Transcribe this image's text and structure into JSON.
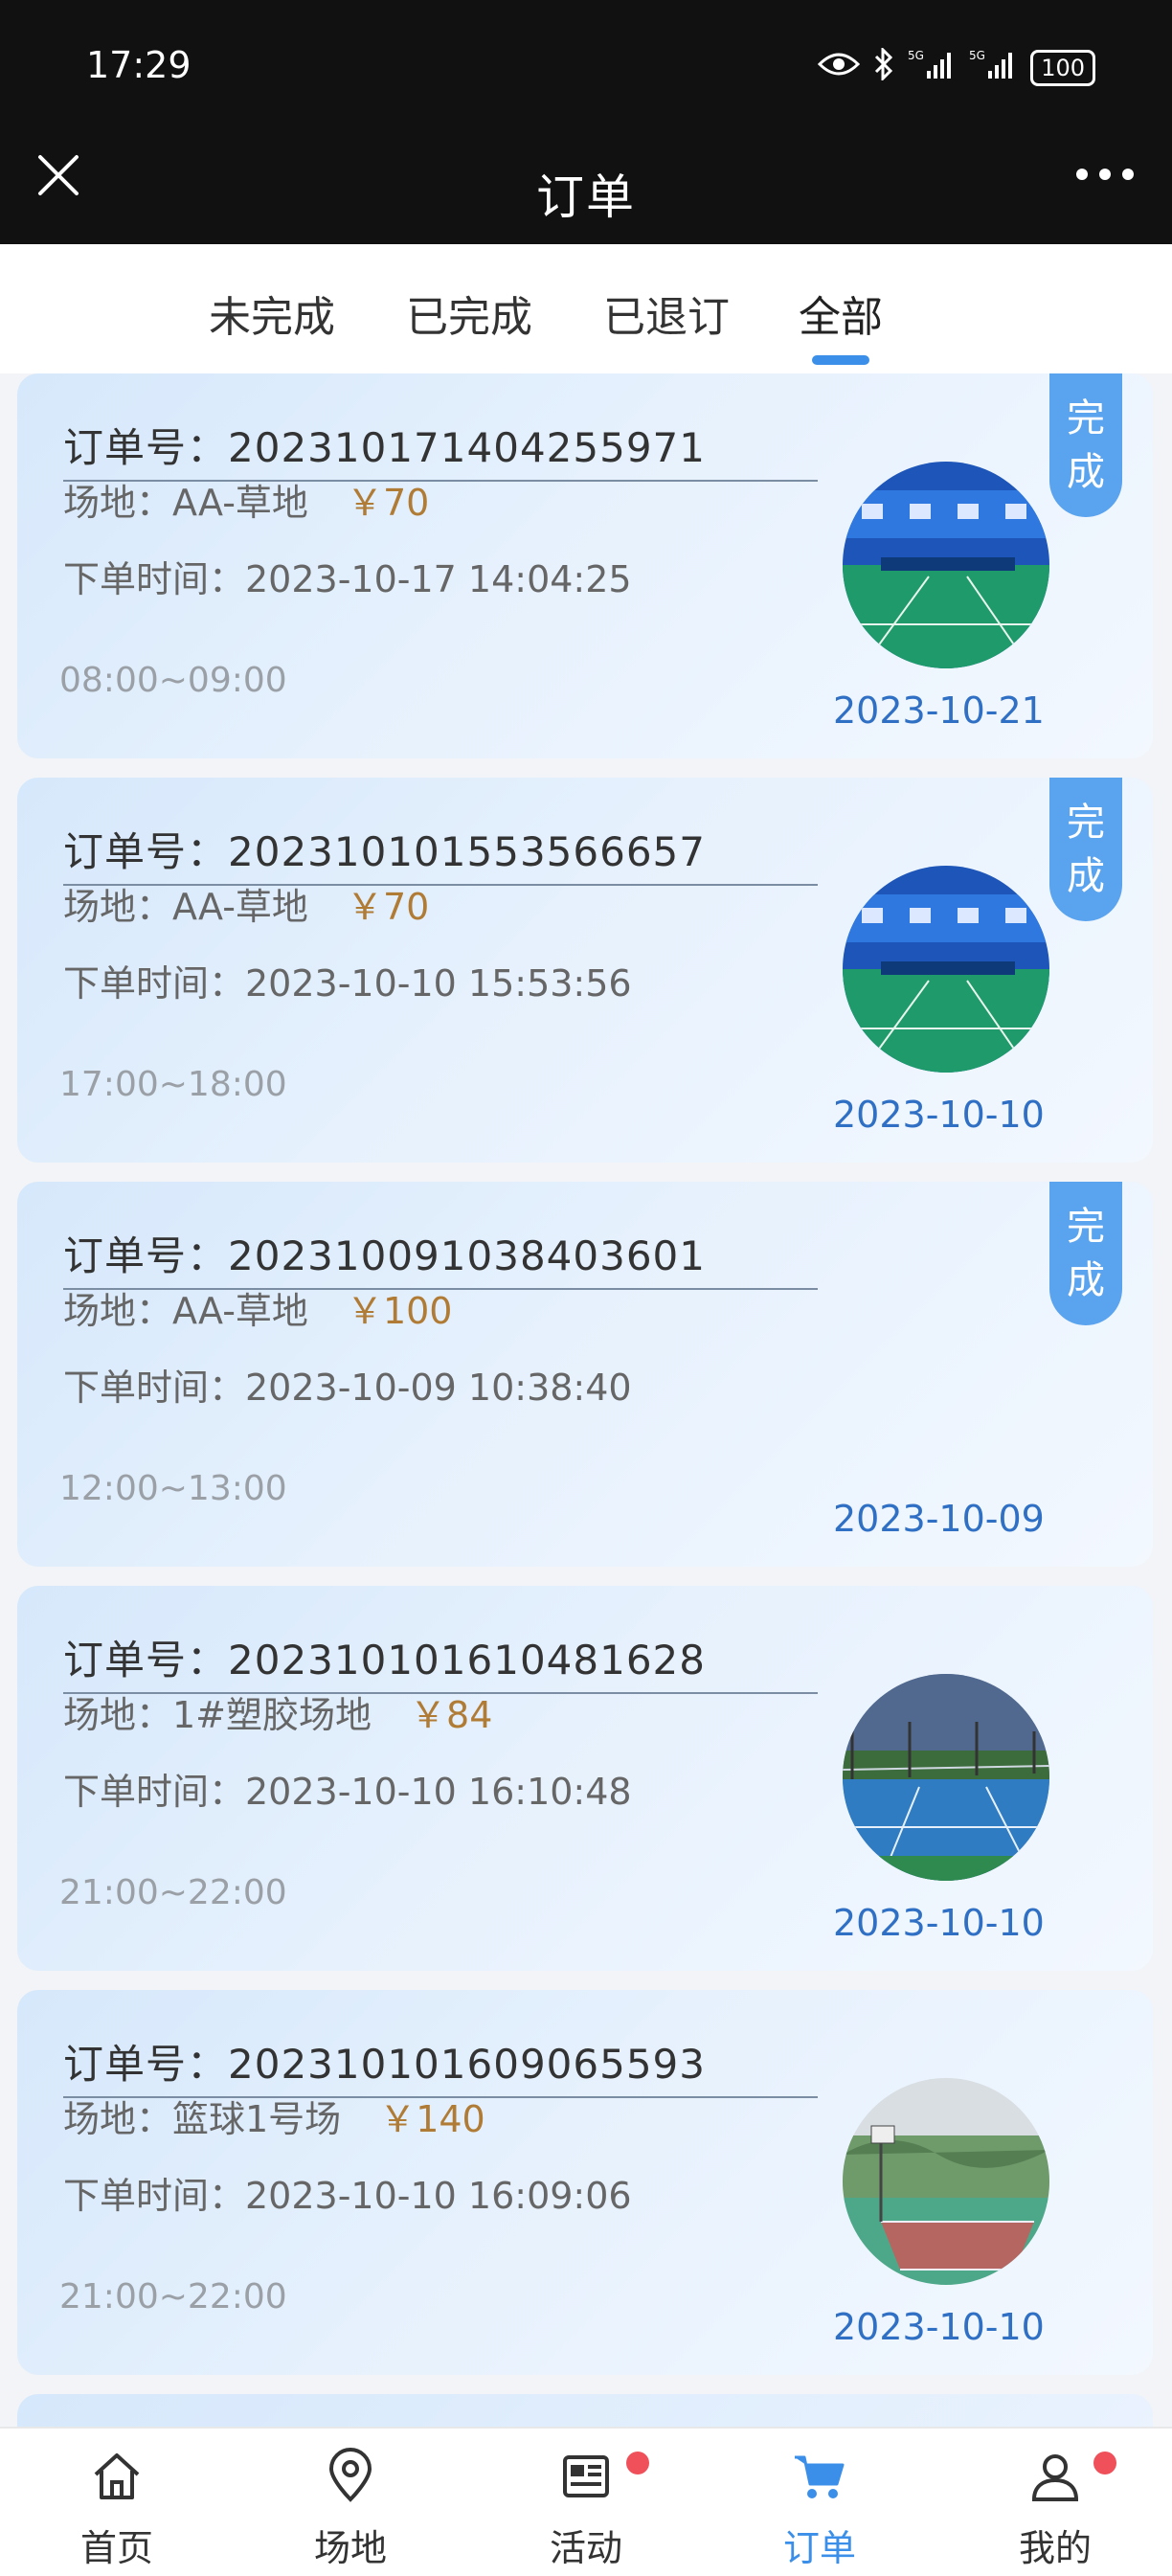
{
  "status_bar": {
    "time": "17:29",
    "battery": "100"
  },
  "nav": {
    "title": "订单"
  },
  "tabs": [
    {
      "label": "未完成"
    },
    {
      "label": "已完成"
    },
    {
      "label": "已退订"
    },
    {
      "label": "全部",
      "active": true
    }
  ],
  "orders": [
    {
      "order_no": "订单号：202310171404255971",
      "venue": "场地：AA-草地",
      "price": "￥70",
      "order_time": "下单时间：2023-10-17 14:04:25",
      "time_slot": "08:00~09:00",
      "date": "2023-10-21",
      "badge": [
        "完",
        "成"
      ],
      "thumb": "badminton-court"
    },
    {
      "order_no": "订单号：202310101553566657",
      "venue": "场地：AA-草地",
      "price": "￥70",
      "order_time": "下单时间：2023-10-10 15:53:56",
      "time_slot": "17:00~18:00",
      "date": "2023-10-10",
      "badge": [
        "完",
        "成"
      ],
      "thumb": "badminton-court"
    },
    {
      "order_no": "订单号：202310091038403601",
      "venue": "场地：AA-草地",
      "price": "￥100",
      "order_time": "下单时间：2023-10-09 10:38:40",
      "time_slot": "12:00~13:00",
      "date": "2023-10-09",
      "badge": [
        "完",
        "成"
      ],
      "thumb": ""
    },
    {
      "order_no": "订单号：202310101610481628",
      "venue": "场地：1#塑胶场地",
      "price": "￥84",
      "order_time": "下单时间：2023-10-10 16:10:48",
      "time_slot": "21:00~22:00",
      "date": "2023-10-10",
      "badge": [],
      "thumb": "tennis-court"
    },
    {
      "order_no": "订单号：202310101609065593",
      "venue": "场地：篮球1号场",
      "price": "￥140",
      "order_time": "下单时间：2023-10-10 16:09:06",
      "time_slot": "21:00~22:00",
      "date": "2023-10-10",
      "badge": [],
      "thumb": "basketball-court"
    }
  ],
  "bottom_nav": [
    {
      "label": "首页",
      "icon": "home-icon"
    },
    {
      "label": "场地",
      "icon": "location-pin-icon"
    },
    {
      "label": "活动",
      "icon": "news-icon",
      "dot": true
    },
    {
      "label": "订单",
      "icon": "cart-icon",
      "active": true
    },
    {
      "label": "我的",
      "icon": "person-icon",
      "dot": true
    }
  ],
  "colors": {
    "accent": "#3b8fe8",
    "price": "#b07b35",
    "date": "#2f6fc4",
    "badge": "#5aa3ee",
    "dot": "#f0505a"
  }
}
